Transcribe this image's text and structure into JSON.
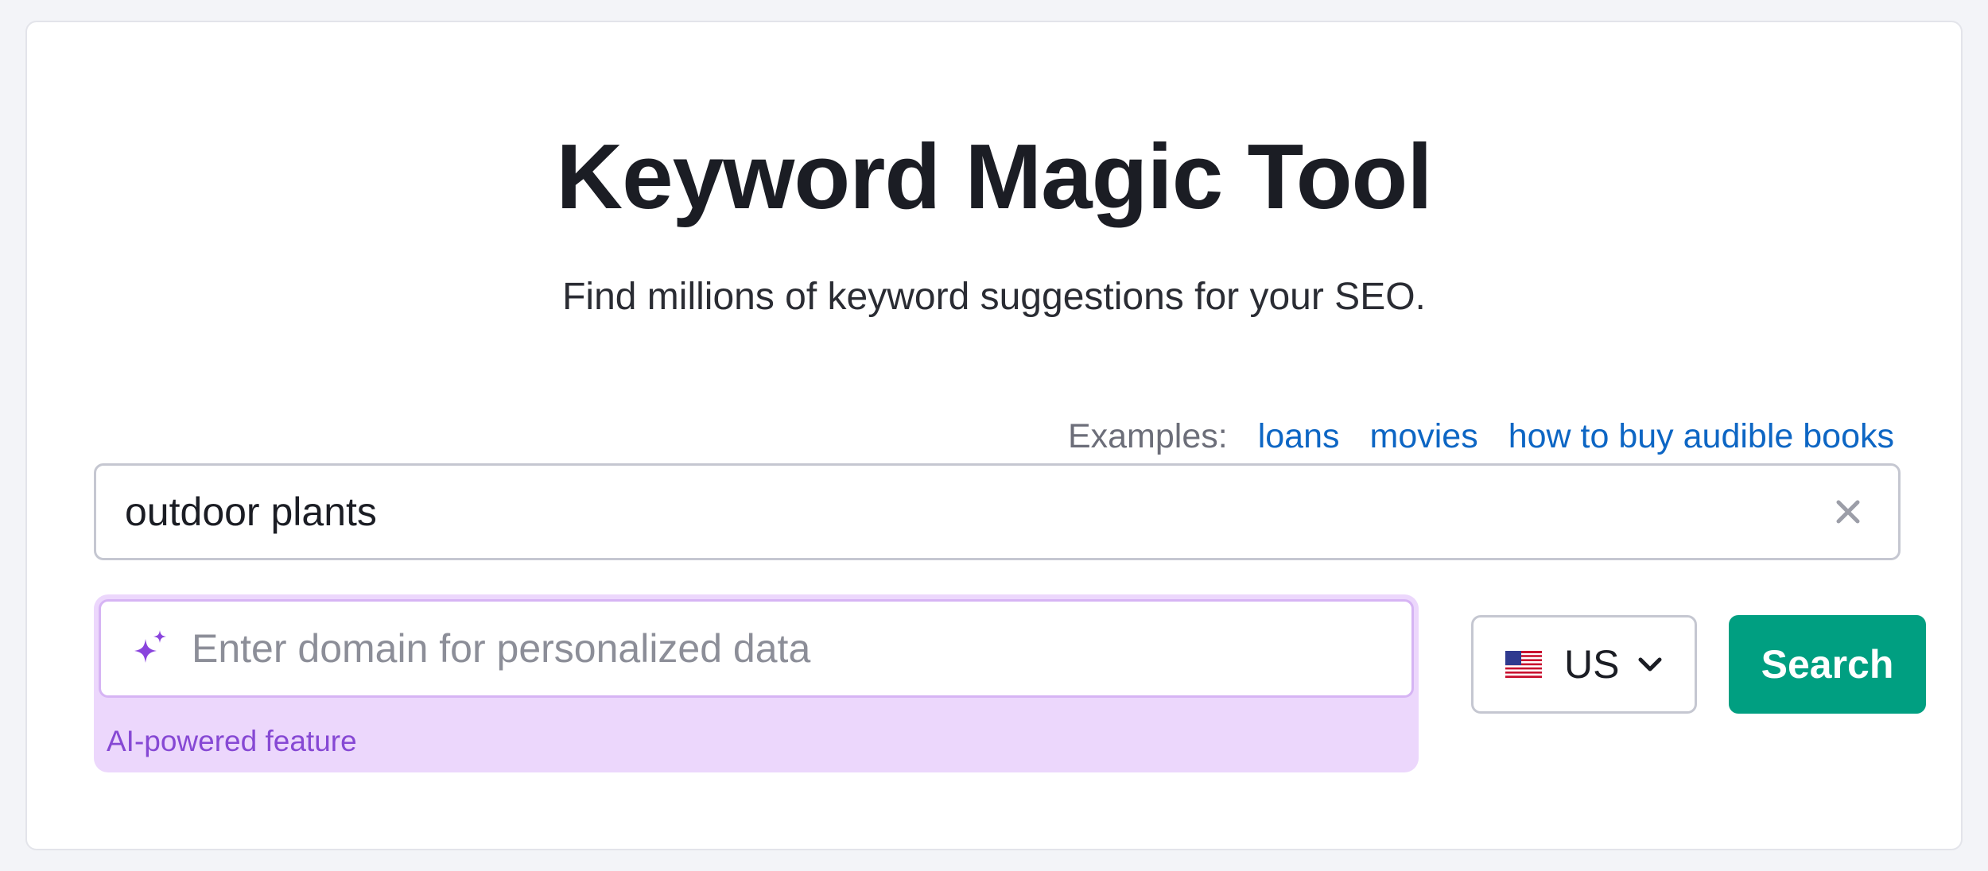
{
  "page": {
    "title": "Keyword Magic Tool",
    "subtitle": "Find millions of keyword suggestions for your SEO."
  },
  "examples": {
    "label": "Examples:",
    "items": [
      "loans",
      "movies",
      "how to buy audible books"
    ]
  },
  "keyword_input": {
    "value": "outdoor plants",
    "clear_icon": "close-icon"
  },
  "domain_input": {
    "value": "",
    "placeholder": "Enter domain for personalized data",
    "icon": "sparkle-icon",
    "caption": "AI-powered feature"
  },
  "database_select": {
    "selected": "US",
    "flag_icon": "us-flag-icon",
    "chevron_icon": "chevron-down-icon"
  },
  "search_button": {
    "label": "Search"
  },
  "colors": {
    "page_bg": "#f3f4f8",
    "card_bg": "#ffffff",
    "link": "#0d66c4",
    "primary": "#009f81",
    "ai_bg": "#ecd7fc",
    "ai_accent": "#8648d4"
  }
}
